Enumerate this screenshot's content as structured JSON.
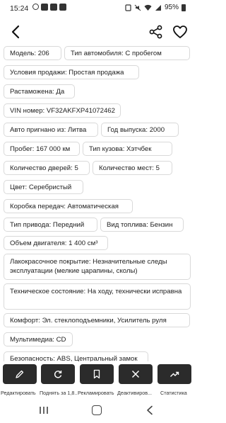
{
  "status_bar": {
    "time": "15:24",
    "battery": "95%",
    "icons": [
      "whatsapp-icon",
      "app-icon",
      "app-icon",
      "app-icon",
      "sim-icon",
      "mute-icon",
      "wifi-icon",
      "signal-icon",
      "battery-icon"
    ]
  },
  "app_bar": {
    "icons": [
      "back-arrow-icon",
      "share-icon",
      "heart-icon"
    ]
  },
  "chips": [
    "Модель: 206",
    "Тип автомобиля: С пробегом",
    "Условия продажи: Простая продажа",
    "Растаможена: Да",
    "VIN номер: VF32AKFXP41072462",
    "Авто пригнано из: Литва",
    "Год выпуска: 2000",
    "Пробег: 167 000 км",
    "Тип кузова: Хэтчбек",
    "Количество дверей: 5",
    "Количество мест: 5",
    "Цвет: Серебристый",
    "Коробка передач: Автоматическая",
    "Тип привода: Передний",
    "Вид топлива: Бензин",
    "Объем двигателя: 1 400 см³",
    "Лакокрасочное покрытие: Незначительные следы эксплуатации (мелкие царапины, сколы)",
    "Техническое состояние: На ходу, технически исправна",
    "Комфорт: Эл. стеклоподъемники, Усилитель руля",
    "Мультимедиа: CD",
    "Безопасность: ABS, Центральный замок"
  ],
  "toolbar": {
    "buttons": [
      {
        "label": "Редактировать",
        "icon": "pencil-icon"
      },
      {
        "label": "Поднять за 1,8...",
        "icon": "refresh-icon"
      },
      {
        "label": "Рекламировать",
        "icon": "bookmark-icon"
      },
      {
        "label": "Деактивиров...",
        "icon": "close-icon"
      },
      {
        "label": "Статистика",
        "icon": "trending-up-icon"
      }
    ]
  },
  "nav_bar": {
    "icons": [
      "recents-icon",
      "home-icon",
      "back-icon"
    ]
  }
}
